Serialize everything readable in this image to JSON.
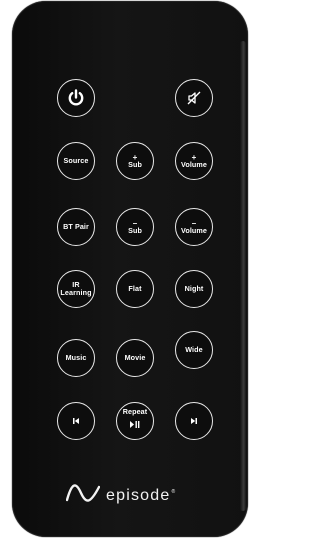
{
  "remote": {
    "buttons": {
      "power": {
        "icon": "power-icon"
      },
      "mute": {
        "icon": "speaker-mute-icon"
      },
      "source": {
        "label": "Source"
      },
      "sub_up": {
        "symbol": "+",
        "label": "Sub"
      },
      "volume_up": {
        "symbol": "+",
        "label": "Volume"
      },
      "bt_pair": {
        "label": "BT Pair"
      },
      "sub_down": {
        "symbol": "–",
        "label": "Sub"
      },
      "volume_down": {
        "symbol": "–",
        "label": "Volume"
      },
      "ir_learning": {
        "line1": "IR",
        "line2": "Learning"
      },
      "flat": {
        "label": "Flat"
      },
      "night": {
        "label": "Night"
      },
      "music": {
        "label": "Music"
      },
      "movie": {
        "label": "Movie"
      },
      "wide": {
        "label": "Wide"
      },
      "previous": {
        "icon": "skip-previous-icon"
      },
      "repeat": {
        "label": "Repeat",
        "icon": "play-pause-icon"
      },
      "next": {
        "icon": "skip-next-icon"
      }
    },
    "logo": {
      "text": "episode",
      "mark": "®",
      "icon": "wave-logo-icon"
    }
  },
  "colors": {
    "body": "#111111",
    "button_border": "#e8e8e8",
    "text": "#ffffff",
    "background": "#ffffff"
  }
}
